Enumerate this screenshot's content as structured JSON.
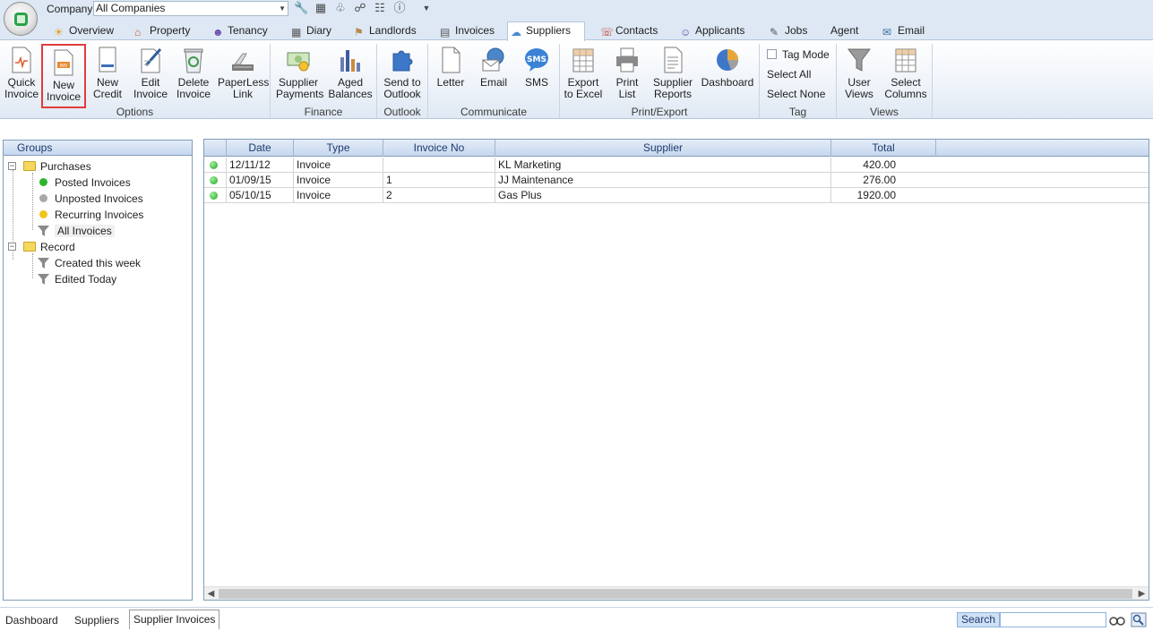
{
  "company": {
    "label": "Company",
    "value": "All Companies"
  },
  "quick_access": [
    "wrench-icon",
    "calculator-icon",
    "share-icon",
    "network-icon",
    "document-icon",
    "help-icon",
    "dropdown-arrow-icon"
  ],
  "tabs": [
    {
      "label": "Overview",
      "icon": "overview-icon"
    },
    {
      "label": "Property",
      "icon": "house-icon"
    },
    {
      "label": "Tenancy",
      "icon": "people-icon"
    },
    {
      "label": "Diary",
      "icon": "calendar-icon"
    },
    {
      "label": "Landlords",
      "icon": "landlord-icon"
    },
    {
      "label": "Invoices",
      "icon": "invoice-icon"
    },
    {
      "label": "Suppliers",
      "icon": "supplier-icon",
      "active": true
    },
    {
      "label": "Contacts",
      "icon": "contacts-icon"
    },
    {
      "label": "Applicants",
      "icon": "applicants-icon"
    },
    {
      "label": "Jobs",
      "icon": "jobs-icon"
    },
    {
      "label": "Agent",
      "icon": ""
    },
    {
      "label": "Email",
      "icon": "email-icon"
    }
  ],
  "ribbon": {
    "quick_invoice": [
      "Quick",
      "Invoice"
    ],
    "new_invoice": [
      "New",
      "Invoice"
    ],
    "new_credit": [
      "New",
      "Credit"
    ],
    "edit_invoice": [
      "Edit",
      "Invoice"
    ],
    "delete_invoice": [
      "Delete",
      "Invoice"
    ],
    "paperless_link": [
      "PaperLess",
      "Link"
    ],
    "supplier_payments": [
      "Supplier",
      "Payments"
    ],
    "aged_balances": [
      "Aged",
      "Balances"
    ],
    "send_to_outlook": [
      "Send to",
      "Outlook"
    ],
    "letter": "Letter",
    "email": "Email",
    "sms": "SMS",
    "export_to_excel": [
      "Export",
      "to Excel"
    ],
    "print_list": [
      "Print",
      "List"
    ],
    "supplier_reports": [
      "Supplier",
      "Reports"
    ],
    "dashboard": "Dashboard",
    "tag_mode": "Tag Mode",
    "select_all": "Select All",
    "select_none": "Select None",
    "user_views": [
      "User",
      "Views"
    ],
    "select_columns": [
      "Select",
      "Columns"
    ],
    "groups": {
      "options": "Options",
      "finance": "Finance",
      "outlook": "Outlook",
      "communicate": "Communicate",
      "print_export": "Print/Export",
      "tag": "Tag",
      "views": "Views"
    }
  },
  "groups_panel": {
    "header": "Groups",
    "purchases": "Purchases",
    "posted": "Posted Invoices",
    "unposted": "Unposted Invoices",
    "recurring": "Recurring Invoices",
    "all": "All Invoices",
    "record": "Record",
    "created_week": "Created this week",
    "edited_today": "Edited Today"
  },
  "grid": {
    "columns": [
      "Date",
      "Type",
      "Invoice No",
      "Supplier",
      "Total"
    ],
    "rows": [
      {
        "date": "12/11/12",
        "type": "Invoice",
        "invoice_no": "",
        "supplier": "KL Marketing",
        "total": "420.00"
      },
      {
        "date": "01/09/15",
        "type": "Invoice",
        "invoice_no": "1",
        "supplier": "JJ Maintenance",
        "total": "276.00"
      },
      {
        "date": "05/10/15",
        "type": "Invoice",
        "invoice_no": "2",
        "supplier": "Gas Plus",
        "total": "1920.00"
      }
    ]
  },
  "bottom_tabs": [
    "Dashboard",
    "Suppliers",
    "Supplier Invoices"
  ],
  "search": {
    "label": "Search",
    "value": ""
  },
  "colors": {
    "accent_selected": "#e03c3c",
    "status_green": "#1fa41f",
    "header_blue": "#1e3a6e"
  }
}
